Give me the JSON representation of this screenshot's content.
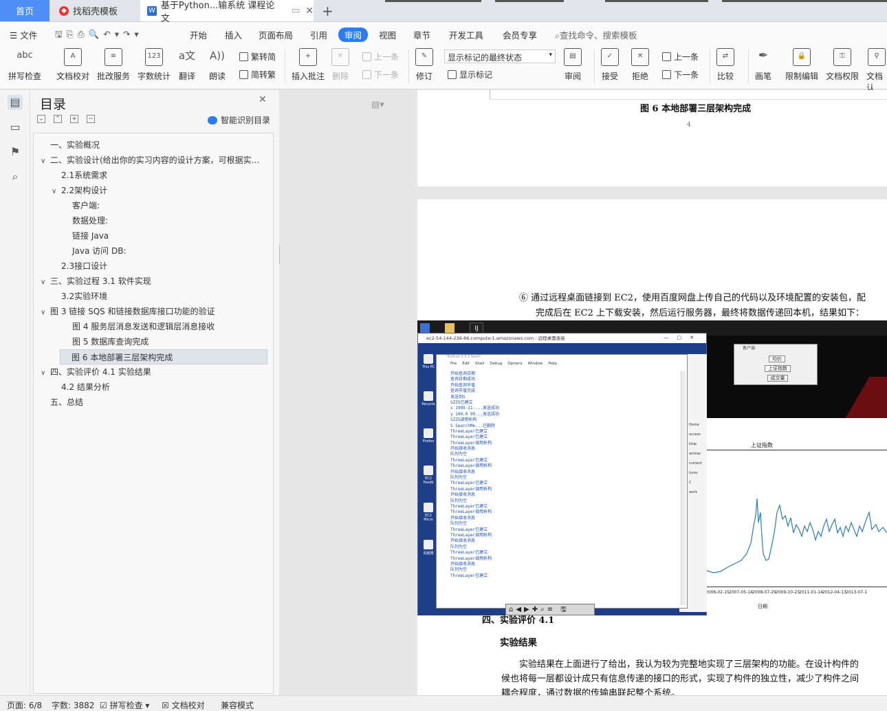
{
  "tabs": {
    "home": "首页",
    "template": "找稻壳模板",
    "doc": "基于Python...输系统 课程论文"
  },
  "menu": {
    "file": "文件",
    "items": [
      "开始",
      "插入",
      "页面布局",
      "引用",
      "审阅",
      "视图",
      "章节",
      "开发工具",
      "会员专享"
    ],
    "active": "审阅",
    "search_placeholder": "查找命令、搜索模板"
  },
  "toolbar": {
    "spell": "拼写检查",
    "proof": "文档校对",
    "revise_service": "批改服务",
    "word_count": "字数统计",
    "translate": "翻译",
    "read": "朗读",
    "trad": "繁转简",
    "simp": "简转繁",
    "insert_comment": "插入批注",
    "delete": "删除",
    "prev_comment": "上一条",
    "next_comment": "下一条",
    "track": "修订",
    "markup_state": "显示标记的最终状态",
    "show_markup": "显示标记",
    "review": "审阅",
    "accept": "接受",
    "reject": "拒绝",
    "prev": "上一条",
    "next": "下一条",
    "compare": "比较",
    "pen": "画笔",
    "restrict": "限制编辑",
    "doc_perm": "文档权限",
    "doc_more": "文档认"
  },
  "toc": {
    "title": "目录",
    "smart": "智能识别目录",
    "items": [
      {
        "text": "一、实验概况",
        "level": 1,
        "arrow": ""
      },
      {
        "text": "二、实验设计(给出你的实习内容的设计方案，可根据实...",
        "level": 1,
        "arrow": "∨"
      },
      {
        "text": "2.1系统需求",
        "level": 2,
        "arrow": ""
      },
      {
        "text": "2.2架构设计",
        "level": 2,
        "arrow": "∨"
      },
      {
        "text": "客户端:",
        "level": 3,
        "arrow": ""
      },
      {
        "text": "数据处理:",
        "level": 3,
        "arrow": ""
      },
      {
        "text": "链接 Java",
        "level": 3,
        "arrow": ""
      },
      {
        "text": "Java 访问 DB:",
        "level": 3,
        "arrow": ""
      },
      {
        "text": "2.3接口设计",
        "level": 2,
        "arrow": ""
      },
      {
        "text": "三、实验过程  3.1 软件实现",
        "level": 1,
        "arrow": "∨"
      },
      {
        "text": "3.2实验环境",
        "level": 2,
        "arrow": ""
      },
      {
        "text": "图 3 链接 SQS 和链接数据库接口功能的验证",
        "level": 1,
        "arrow": "∨"
      },
      {
        "text": "图 4 服务层消息发送和逻辑层消息接收",
        "level": 3,
        "arrow": ""
      },
      {
        "text": "图 5 数据库查询完成",
        "level": 3,
        "arrow": ""
      },
      {
        "text": "图 6 本地部署三层架构完成",
        "level": 3,
        "arrow": "",
        "selected": true
      },
      {
        "text": "四、实验评价  4.1 实验结果",
        "level": 1,
        "arrow": "∨"
      },
      {
        "text": "4.2 结果分析",
        "level": 2,
        "arrow": ""
      },
      {
        "text": "五、总结",
        "level": 1,
        "arrow": ""
      }
    ]
  },
  "doc": {
    "caption": "图 6 本地部署三层架构完成",
    "page_num": "4",
    "para1": "⑥ 通过远程桌面链接到 EC2，使用百度网盘上传自己的代码以及环境配置的安装包，配",
    "para2": "完成后在 EC2 上下载安装，然后运行服务器，最终将数据传递回本机，结果如下：",
    "heading4": "四、实验评价 4.1",
    "heading_result": "实验结果",
    "body1": "实验结果在上面进行了给出，我认为较为完整地实现了三层架构的功能。在设计构件的",
    "body2": "候也将每一层都设计成只有信息传递的接口的形式，实现了构件的独立性，减少了构件之间",
    "body3": "耦合程度，通过数据的传输串联起整个系统。"
  },
  "screenshot": {
    "rdp_title": "ec2-54-144-236-86.compute-1.amazonaws.com - 远程桌面连接",
    "shell_title": "*Python 3.5.2 Shell*",
    "shell_menu": [
      "File",
      "Edit",
      "Shell",
      "Debug",
      "Options",
      "Window",
      "Help"
    ],
    "client_title": "客户端",
    "client_buttons": [
      "均价",
      "上证指数",
      "成交量"
    ],
    "chart_title": "上证指数",
    "chart_xlabel": "日期",
    "chart_ticks": [
      "2006-02-15",
      "2007-05-14",
      "2008-07-29",
      "2009-10-23",
      "2011-01-14",
      "2012-04-13",
      "2013-07-1"
    ],
    "desktop_icons": [
      "This PC",
      "Recycle",
      "Firefox",
      "EC2 Feedb",
      "EC2 Micro",
      "百度网"
    ],
    "explorer_items": [
      "Home",
      "access",
      "ktop",
      "wnloac",
      "cument",
      "tures",
      "C",
      "work"
    ],
    "shell_lines": [
      "开始查询日期",
      "查询日期成功",
      "开始查询市值",
      "查询市值完成",
      "发送到S",
      "SZZS已建立",
      "x 1999-11-...发送成功",
      "y 100.0 99...发送成功",
      "SZZS调用析构",
      "S SearchMe...已删除",
      "ThreeLayer已建立",
      "ThreeLayer已建立",
      "ThreeLayer调用析构",
      "开始接收消息",
      "队列为空",
      "ThreeLayer已建立",
      "ThreeLayer调用析构",
      "开始接收消息",
      "队列为空",
      "ThreeLayer已建立",
      "ThreeLayer调用析构",
      "开始接收消息",
      "队列为空",
      "ThreeLayer已建立",
      "ThreeLayer调用析构",
      "开始接收消息",
      "队列为空",
      "ThreeLayer已建立",
      "ThreeLayer调用析构",
      "开始接收消息",
      "队列为空",
      "ThreeLayer已建立",
      "ThreeLayer调用析构",
      "开始接收消息",
      "队列为空",
      "ThreeLayer已建立"
    ]
  },
  "status": {
    "page": "页面: 6/8",
    "words": "字数: 3882",
    "spell": "拼写检查",
    "proof": "文档校对",
    "compat": "兼容模式"
  }
}
